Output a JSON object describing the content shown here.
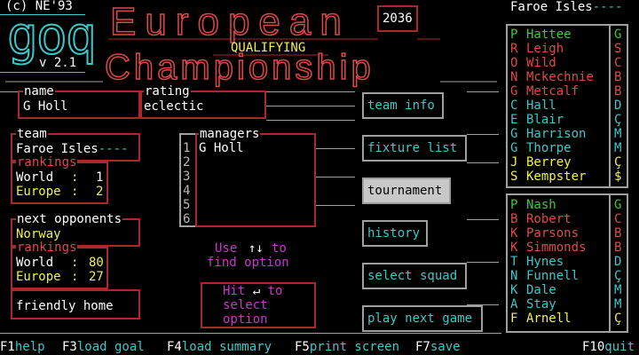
{
  "header": {
    "copyright": "(c) NE'93",
    "logo": "goq",
    "version": "v 2.1",
    "title_line1": "European",
    "year": "2036",
    "qualifying": "QUALIFYING",
    "title_line2": "Championship"
  },
  "name_panel": {
    "caption": "name",
    "value": "G Holl"
  },
  "rating_panel": {
    "caption": "rating",
    "value": "eclectic"
  },
  "team_panel": {
    "caption": "team",
    "team": "Faroe Isles",
    "team_tail": "----",
    "rankings_caption": "rankings",
    "world_label": "World",
    "world_value": "1",
    "europe_label": "Europe",
    "europe_value": "2"
  },
  "next_panel": {
    "caption": "next opponents",
    "team": "Norway",
    "rankings_caption": "rankings",
    "world_label": "World",
    "world_value": "80",
    "europe_label": "Europe",
    "europe_value": "27",
    "fixture": "friendly home"
  },
  "managers_panel": {
    "caption": "managers",
    "numbers": [
      "1",
      "2",
      "3",
      "4",
      "5",
      "6"
    ],
    "names": [
      "G Holl",
      "",
      "",
      "",
      "",
      ""
    ]
  },
  "hints": {
    "use_text": "Use",
    "use_keys": "↑↓",
    "use_to": "to",
    "find_option": "find option",
    "hit_text": "Hit",
    "hit_key": "↵",
    "hit_to": "to",
    "select": "select",
    "option": "option"
  },
  "menu": [
    {
      "label": "team info",
      "selected": false
    },
    {
      "label": "fixture list",
      "selected": false
    },
    {
      "label": "tournament",
      "selected": true
    },
    {
      "label": "history",
      "selected": false
    },
    {
      "label": "select squad",
      "selected": false
    },
    {
      "label": "play next game",
      "selected": false
    }
  ],
  "squad": {
    "team": "Faroe Isles",
    "team_tail": "----",
    "starters": [
      {
        "pos": "P",
        "name": "Hattee",
        "pos_color": "#3cc83c",
        "name_color": "#3cc83c",
        "right": "G",
        "right_color": "#3cc83c"
      },
      {
        "pos": "R",
        "name": "Leigh",
        "pos_color": "#e04848",
        "name_color": "#e04848",
        "right": "S",
        "right_color": "#e04848"
      },
      {
        "pos": "O",
        "name": "Wild",
        "pos_color": "#e04848",
        "name_color": "#e04848",
        "right": "C",
        "right_color": "#e04848"
      },
      {
        "pos": "N",
        "name": "Mckechnie",
        "pos_color": "#e04848",
        "name_color": "#e04848",
        "right": "B",
        "right_color": "#e04848"
      },
      {
        "pos": "G",
        "name": "Metcalf",
        "pos_color": "#e04848",
        "name_color": "#e04848",
        "right": "B",
        "right_color": "#e04848"
      },
      {
        "pos": "C",
        "name": "Hall",
        "pos_color": "#3cc8c8",
        "name_color": "#3cc8c8",
        "right": "D",
        "right_color": "#3cc8c8"
      },
      {
        "pos": "E",
        "name": "Blair",
        "pos_color": "#3cc8c8",
        "name_color": "#3cc8c8",
        "right": "Ç",
        "right_color": "#3cc8c8"
      },
      {
        "pos": "G",
        "name": "Harrison",
        "pos_color": "#3cc8c8",
        "name_color": "#3cc8c8",
        "right": "M",
        "right_color": "#3cc8c8"
      },
      {
        "pos": "G",
        "name": "Thorpe",
        "pos_color": "#3cc8c8",
        "name_color": "#3cc8c8",
        "right": "M",
        "right_color": "#3cc8c8"
      },
      {
        "pos": "J",
        "name": "Berrey",
        "pos_color": "#f0f050",
        "name_color": "#f0f050",
        "right": "Ç",
        "right_color": "#f0f050"
      },
      {
        "pos": "S",
        "name": "Kempster",
        "pos_color": "#f0f050",
        "name_color": "#f0f050",
        "right": "$",
        "right_color": "#f0f050"
      }
    ],
    "subs": [
      {
        "pos": "P",
        "name": "Nash",
        "pos_color": "#3cc83c",
        "name_color": "#3cc83c",
        "right": "G",
        "right_color": "#3cc83c"
      },
      {
        "pos": "B",
        "name": "Robert",
        "pos_color": "#e04848",
        "name_color": "#e04848",
        "right": "C",
        "right_color": "#e04848"
      },
      {
        "pos": "K",
        "name": "Parsons",
        "pos_color": "#e04848",
        "name_color": "#e04848",
        "right": "B",
        "right_color": "#e04848"
      },
      {
        "pos": "K",
        "name": "Simmonds",
        "pos_color": "#e04848",
        "name_color": "#e04848",
        "right": "B",
        "right_color": "#e04848"
      },
      {
        "pos": "T",
        "name": "Hynes",
        "pos_color": "#3cc8c8",
        "name_color": "#3cc8c8",
        "right": "D",
        "right_color": "#3cc8c8"
      },
      {
        "pos": "N",
        "name": "Funnell",
        "pos_color": "#3cc8c8",
        "name_color": "#3cc8c8",
        "right": "Ç",
        "right_color": "#3cc8c8"
      },
      {
        "pos": "K",
        "name": "Dale",
        "pos_color": "#3cc8c8",
        "name_color": "#3cc8c8",
        "right": "M",
        "right_color": "#3cc8c8"
      },
      {
        "pos": "A",
        "name": "Stay",
        "pos_color": "#3cc8c8",
        "name_color": "#3cc8c8",
        "right": "M",
        "right_color": "#3cc8c8"
      },
      {
        "pos": "F",
        "name": "Arnell",
        "pos_color": "#f0f050",
        "name_color": "#f0f050",
        "right": "Ç",
        "right_color": "#f0f050"
      }
    ]
  },
  "footer": [
    {
      "key": "F1",
      "label": "help"
    },
    {
      "key": "F3",
      "label": "load goal"
    },
    {
      "key": "F4",
      "label": "load summary"
    },
    {
      "key": "F5",
      "label": "print screen"
    },
    {
      "key": "F7",
      "label": "save"
    },
    {
      "key": "F10",
      "label": "quit"
    }
  ]
}
